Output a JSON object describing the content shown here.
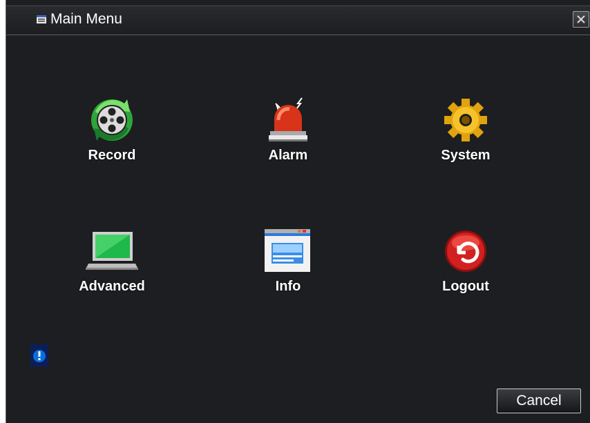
{
  "window": {
    "title": "Main Menu",
    "title_icon": "menu-window-icon",
    "close_icon": "close-icon"
  },
  "menu": {
    "items": [
      {
        "label": "Record",
        "icon": "film-reel-icon"
      },
      {
        "label": "Alarm",
        "icon": "alarm-siren-icon"
      },
      {
        "label": "System",
        "icon": "gear-icon"
      },
      {
        "label": "Advanced",
        "icon": "laptop-icon"
      },
      {
        "label": "Info",
        "icon": "info-window-icon"
      },
      {
        "label": "Logout",
        "icon": "logout-icon"
      }
    ]
  },
  "status": {
    "icon": "alert-icon",
    "color": "#0a6fd8"
  },
  "footer": {
    "cancel_label": "Cancel"
  },
  "colors": {
    "background": "#1d1e21",
    "text": "#ffffff"
  }
}
